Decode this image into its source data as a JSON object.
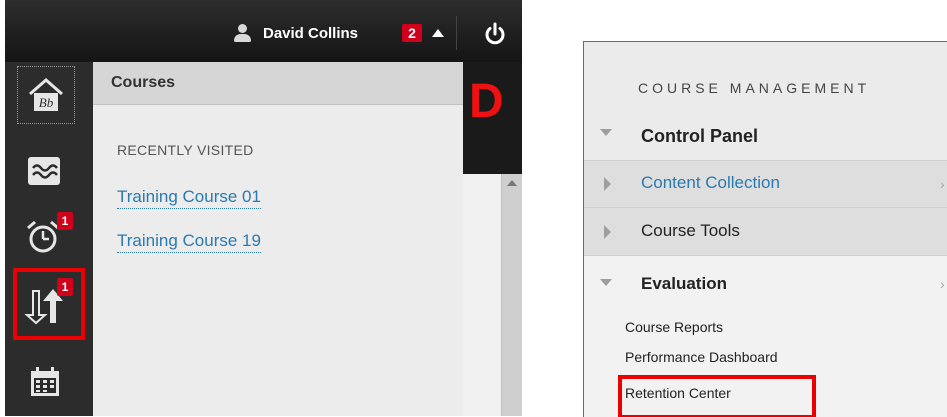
{
  "topbar": {
    "user_name": "David Collins",
    "notification_count": "2"
  },
  "sidebar": {
    "items": [
      {
        "name": "home-icon",
        "badge": ""
      },
      {
        "name": "stream-icon",
        "badge": ""
      },
      {
        "name": "alarm-clock-icon",
        "badge": "1"
      },
      {
        "name": "updates-icon",
        "badge": "1",
        "highlighted": true
      },
      {
        "name": "calendar-icon",
        "badge": ""
      }
    ]
  },
  "flyout": {
    "title": "Courses",
    "section_label": "RECENTLY VISITED",
    "courses": [
      "Training Course 01",
      "Training Course 19"
    ]
  },
  "background_page": {
    "logo_fragment": "D"
  },
  "course_management": {
    "heading": "COURSE MANAGEMENT",
    "items": [
      {
        "label": "Control Panel",
        "state": "expanded",
        "bold": true
      },
      {
        "label": "Content Collection",
        "state": "collapsed",
        "link": true
      },
      {
        "label": "Course Tools",
        "state": "collapsed"
      },
      {
        "label": "Evaluation",
        "state": "expanded",
        "bold": true
      }
    ],
    "evaluation_items": [
      "Course Reports",
      "Performance Dashboard",
      "Retention Center"
    ],
    "highlighted_item": "Retention Center"
  },
  "colors": {
    "highlight": "#ea0000",
    "badge": "#d0021b",
    "link": "#2a7ab0"
  }
}
